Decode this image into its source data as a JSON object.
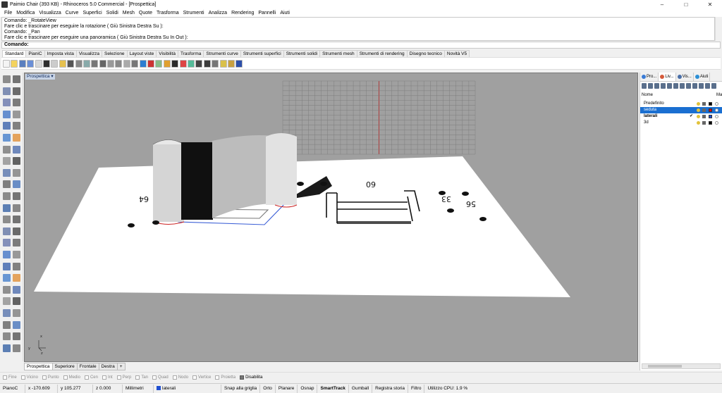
{
  "window": {
    "title": "Paimio Chair (393 KB) - Rhinoceros 5.0 Commercial - [Prospettica]",
    "minimize": "–",
    "maximize": "□",
    "close": "✕"
  },
  "menu": [
    "File",
    "Modifica",
    "Visualizza",
    "Curve",
    "Superfici",
    "Solidi",
    "Mesh",
    "Quote",
    "Trasforma",
    "Strumenti",
    "Analizza",
    "Rendering",
    "Pannelli",
    "Aiuti"
  ],
  "command_history": [
    "Comando: _RotateView",
    "Fare clic e trascinare per eseguire la rotazione ( Giù  Sinistra  Destra  Su ):",
    "Comando: _Pan",
    "Fare clic e trascinare per eseguire una panoramica ( Giù  Sinistra  Destra  Su  In  Out ):"
  ],
  "command_prompt": "Comando:",
  "toolbar_tabs": [
    "Standard",
    "PianiC",
    "Imposta vista",
    "Visualizza",
    "Selezione",
    "Layout viste",
    "Visibilità",
    "Trasforma",
    "Strumenti curve",
    "Strumenti superfici",
    "Strumenti solidi",
    "Strumenti mesh",
    "Strumenti di rendering",
    "Disegno tecnico",
    "Novità V5"
  ],
  "active_toolbar_tab": "Standard",
  "viewport": {
    "title": "Prospettica",
    "dims": [
      "60",
      "33",
      "56",
      "64"
    ],
    "axis_x": "x",
    "axis_y": "y",
    "axis_z": "z"
  },
  "viewport_tabs": [
    "Prospettica",
    "Superiore",
    "Frontale",
    "Destra",
    "+"
  ],
  "osnaps": [
    {
      "label": "Fine",
      "on": false
    },
    {
      "label": "Vicino",
      "on": false
    },
    {
      "label": "Punto",
      "on": false
    },
    {
      "label": "Medio",
      "on": false
    },
    {
      "label": "Cen",
      "on": false
    },
    {
      "label": "Int",
      "on": false
    },
    {
      "label": "Perp",
      "on": false
    },
    {
      "label": "Tan",
      "on": false
    },
    {
      "label": "Quad",
      "on": false
    },
    {
      "label": "Nodo",
      "on": false
    },
    {
      "label": "Vertice",
      "on": false
    },
    {
      "label": "Proietta",
      "on": false
    },
    {
      "label": "Disabilita",
      "on": true
    }
  ],
  "status": {
    "cplane": "PianoC",
    "x": "x -170.609",
    "y": "y 105.277",
    "z": "z 0.000",
    "units": "Millimetri",
    "layer": "laterali",
    "snap": "Snap alla griglia",
    "orto": "Orto",
    "planare": "Planare",
    "osnap": "Osnap",
    "smarttrack": "SmartTrack",
    "gumball": "Gumball",
    "history": "Registra storia",
    "filter": "Filtro",
    "cpu": "Utilizzo CPU: 1.9 %"
  },
  "right_panel": {
    "tabs": [
      "Pro...",
      "Liv...",
      "Vis...",
      "Aiuti"
    ],
    "header_name": "Nome",
    "header_mat": "Ma",
    "layers": [
      {
        "name": "Predefinito",
        "selected": false,
        "bold": false,
        "color": "#000000"
      },
      {
        "name": "seduta",
        "selected": true,
        "bold": false,
        "color": "#e00000"
      },
      {
        "name": "laterali",
        "selected": false,
        "bold": true,
        "color": "#1f4fd1",
        "current": "✔"
      },
      {
        "name": "3d",
        "selected": false,
        "bold": false,
        "color": "#000000"
      }
    ]
  }
}
